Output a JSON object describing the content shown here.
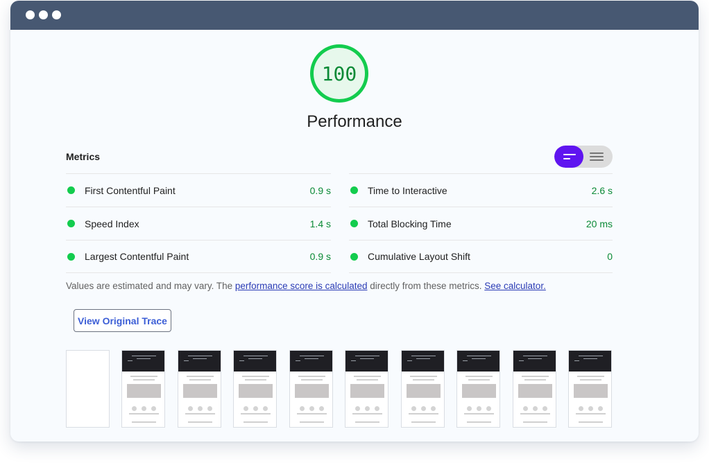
{
  "gauge": {
    "score": "100",
    "title": "Performance"
  },
  "metrics": {
    "heading": "Metrics",
    "toggle": {
      "left_icon": "summary-view-icon",
      "right_icon": "list-view-icon",
      "active": "left"
    },
    "left": [
      {
        "label": "First Contentful Paint",
        "value": "0.9 s"
      },
      {
        "label": "Speed Index",
        "value": "1.4 s"
      },
      {
        "label": "Largest Contentful Paint",
        "value": "0.9 s"
      }
    ],
    "right": [
      {
        "label": "Time to Interactive",
        "value": "2.6 s"
      },
      {
        "label": "Total Blocking Time",
        "value": "20 ms"
      },
      {
        "label": "Cumulative Layout Shift",
        "value": "0"
      }
    ]
  },
  "note": {
    "prefix": "Values are estimated and may vary. The ",
    "link1": "performance score is calculated",
    "middle": " directly from these metrics. ",
    "link2": "See calculator."
  },
  "trace_button": "View Original Trace",
  "colors": {
    "pass_green": "#13cc4e",
    "pass_text": "#0b8a36",
    "toggle_accent": "#5f14f0",
    "titlebar": "#475872",
    "link": "#2a3bb5"
  }
}
